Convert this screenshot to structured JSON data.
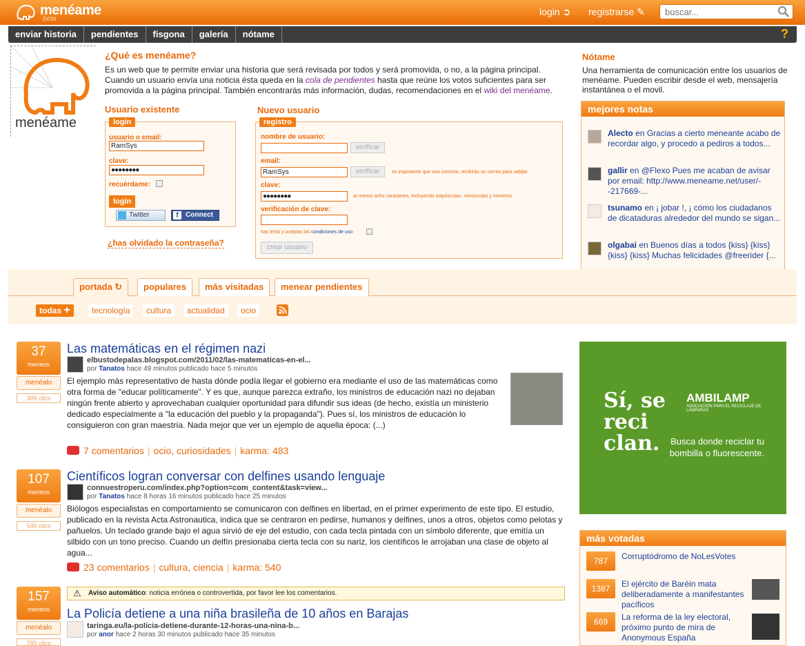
{
  "header": {
    "logo": "menéame",
    "beta": "beta",
    "login": "login",
    "register": "registrarse",
    "search_placeholder": "buscar..."
  },
  "nav": {
    "items": [
      "enviar historia",
      "pendientes",
      "fisgona",
      "galería",
      "nótame"
    ],
    "help": "?"
  },
  "intro": {
    "logo_word": "menéame",
    "title": "¿Qué es menéame?",
    "p1": "Es un web que te permite enviar una historia que será revisada por todos y será promovida, o no, a la página principal.",
    "p2": "Cuando un usuario envía una noticia ésta queda en la",
    "p2_link": "cola de pendientes",
    "p2b": "hasta que reúne los votos suficientes para ser promovida a la página principal. También encontrarás más información, dudas, recomendaciones en el",
    "p2_link2": "wiki del menéame",
    "p2c": "."
  },
  "login": {
    "heading": "Usuario existente",
    "panel": "login",
    "user_label": "usuario o email:",
    "user_value": "RamSys",
    "pass_label": "clave:",
    "pass_value": "●●●●●●●●",
    "remember": "recuérdame:",
    "button": "login",
    "twitter": "Twitter",
    "facebook": "Connect",
    "forgot": "¿has olvidado la contraseña?"
  },
  "register": {
    "heading": "Nuevo usuario",
    "panel": "registro",
    "user_label": "nombre de usuario:",
    "verify": "verificar",
    "email_label": "email:",
    "email_value": "RamSys",
    "email_note": "es importante que sea correcta, recibirás un correo para validar.",
    "pass_label": "clave:",
    "pass_value": "●●●●●●●●",
    "pass_note": "al menos ocho caracteres, incluyendo mayúsculas, minúsculas y números",
    "verify_label": "verificación de clave:",
    "terms": "has leído y aceptas las",
    "terms_link": "condiciones de uso",
    "button": "crear usuario"
  },
  "notame": {
    "title": "Nótame",
    "desc": "Una herramienta de comunicación entre los usuarios de menéame. Pueden escribir desde el web, mensajería instantánea o el movil."
  },
  "mejores": {
    "title": "mejores notas",
    "notes": [
      {
        "user": "Alecto",
        "text": "en Gracias a cierto meneante acabo de recordar algo, y procedo a pediros a todos..."
      },
      {
        "user": "gallir",
        "text": "en @Flexo Pues me acaban de avisar por email: http://www.meneame.net/user/--217669-..."
      },
      {
        "user": "tsunamo",
        "text": "en ¡ jobar !, ¡ cómo los ciudadanos de dicataduras alrededor del mundo se sigan..."
      },
      {
        "user": "olgabai",
        "text": "en Buenos días a todos {kiss} {kiss} {kiss} {kiss} Muchas felicidades @freerider {..."
      }
    ]
  },
  "tabs": [
    "portada",
    "populares",
    "más visitadas",
    "menear pendientes"
  ],
  "subtabs": [
    "todas",
    "tecnología",
    "cultura",
    "actualidad",
    "ocio"
  ],
  "stories": [
    {
      "votes": "37",
      "votes_label": "meneos",
      "menealo": "menéalo",
      "clicks": "389 clics",
      "title": "Las matemáticas en el régimen nazi",
      "url": "elbustodepalas.blogspot.com/2011/02/las-matematicas-en-el...",
      "by": "por",
      "user": "Tanatos",
      "when": "hace 49 minutos publicado hace 5 minutos",
      "body": "El ejemplo más representativo de hasta dónde podía llegar el gobierno era mediante el uso de las matemáticas como otra forma de \"educar políticamente\". Y es que, aunque parezca extraño, los ministros de educación nazi no dejaban ningún frente abierto y aprovechaban cualquier oportunidad para difundir sus ideas (de hecho, existía un ministerio dedicado especialmente a \"la educación del pueblo y la propaganda\"). Pues sí, los ministros de educación lo consiguieron con gran maestría. Nada mejor que ver un ejemplo de aquella época: (...)",
      "comments": "7 comentarios",
      "tags": "ocio, curiosidades",
      "karma": "karma: 483"
    },
    {
      "votes": "107",
      "votes_label": "meneos",
      "menealo": "menéalo",
      "clicks": "546 clics",
      "title": "Científicos logran conversar con delfines usando lenguaje",
      "url": "connuestroperu.com/index.php?option=com_content&task=view...",
      "by": "por",
      "user": "Tanatos",
      "when": "hace 8 horas 16 minutos publicado hace 25 minutos",
      "body": "Biólogos especialistas en comportamiento se comunicaron con delfines en libertad, en el primer experimento de este tipo. El estudio, publicado en la revista Acta Astronautica, indica que se centraron en pedirse, humanos y delfines, unos a otros, objetos como pelotas y pañuelos. Un teclado grande bajo el agua sirvió de eje del estudio, con cada tecla pintada con un símbolo diferente, que emitía un silbido con un tono preciso. Cuando un delfín presionaba cierta tecla con su nariz, los científicos le arrojaban una clase de objeto al agua...",
      "comments": "23 comentarios",
      "tags": "cultura, ciencia",
      "karma": "karma: 540"
    },
    {
      "votes": "157",
      "votes_label": "meneos",
      "menealo": "menéalo",
      "clicks": "789 clics",
      "warn_bold": "Aviso automático",
      "warn_text": ": noticia errónea o controvertida, por favor lee los comentarios.",
      "title": "La Policía detiene a una niña brasileña de 10 años en Barajas",
      "url": "taringa.eu/la-policia-detiene-durante-12-horas-una-nina-b...",
      "by": "por",
      "user": "anor",
      "when": "hace 2 horas 30 minutos publicado hace 35 minutos"
    }
  ],
  "ad": {
    "big": "Sí, se reci clan.",
    "brand": "AMBILAMP",
    "brand_sub": "ASOCIACIÓN PARA EL RECICLAJE DE LÁMPARAS",
    "slogan": "Busca donde reciclar tu bombilla o fluorescente."
  },
  "masvotadas": {
    "title": "más votadas",
    "items": [
      {
        "votes": "787",
        "title": "Corruptódromo de NoLesVotes"
      },
      {
        "votes": "1387",
        "title": "El ejército de Baréin mata deliberadamente a manifestantes pacíficos"
      },
      {
        "votes": "669",
        "title": "La reforma de la ley electoral, próximo punto de mira de Anonymous España"
      }
    ]
  },
  "colors": {
    "accent": "#f07c14",
    "link": "#1a3f99",
    "nav": "#3d3d3d"
  }
}
